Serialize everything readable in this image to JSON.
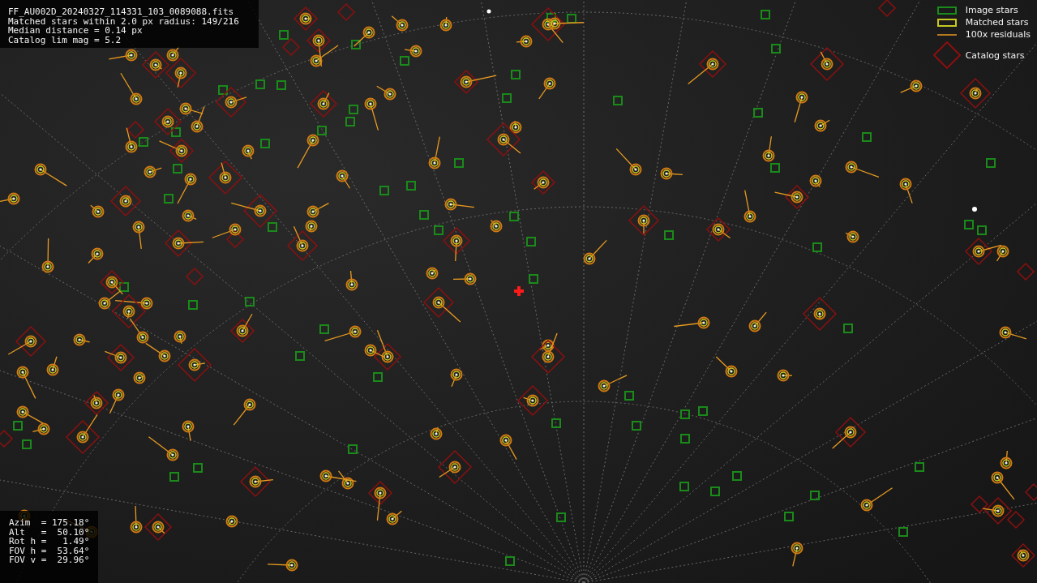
{
  "header": {
    "lines": [
      "FF_AU002D_20240327_114331_103_0089088.fits",
      "Matched stars within 2.0 px radius: 149/216",
      "Median distance = 0.14 px",
      "Catalog lim mag = 5.2"
    ]
  },
  "legend": [
    {
      "kind": "image",
      "label": "Image stars"
    },
    {
      "kind": "matched",
      "label": "Matched stars"
    },
    {
      "kind": "residual",
      "label": "100x residuals"
    },
    {
      "kind": "catalog",
      "label": "Catalog stars"
    }
  ],
  "parameters": [
    "Azim  = 175.18°",
    "Alt   =  50.10°",
    "Rot h =   1.49°",
    "FOV h =  53.64°",
    "FOV v =  29.96°"
  ]
}
